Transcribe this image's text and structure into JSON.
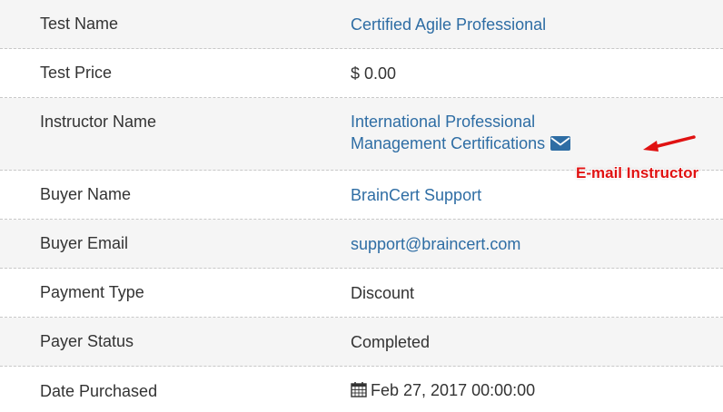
{
  "rows": [
    {
      "label": "Test Name",
      "value": "Certified Agile Professional"
    },
    {
      "label": "Test Price",
      "value": "$ 0.00"
    },
    {
      "label": "Instructor Name",
      "value_line1": "International Professional",
      "value_line2": "Management Certifications",
      "icon": "envelope-icon"
    },
    {
      "label": "Buyer Name",
      "value": "BrainCert Support"
    },
    {
      "label": "Buyer Email",
      "value": "support@braincert.com"
    },
    {
      "label": "Payment Type",
      "value": "Discount"
    },
    {
      "label": "Payer Status",
      "value": "Completed"
    },
    {
      "label": "Date Purchased",
      "value": "Feb 27, 2017 00:00:00",
      "icon": "calendar-icon"
    }
  ],
  "annotation": {
    "text": "E-mail Instructor"
  },
  "colors": {
    "link": "#2e6da4",
    "text": "#333333",
    "annotation": "#e01212",
    "shaded_row": "#f5f5f5"
  }
}
